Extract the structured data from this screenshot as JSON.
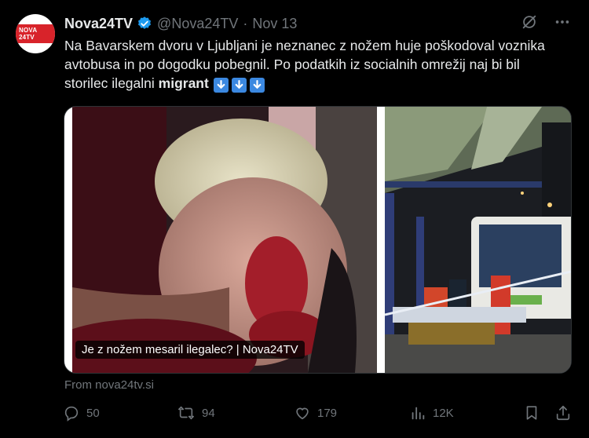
{
  "author": {
    "name": "Nova24TV",
    "handle": "@Nova24TV",
    "separator": "·",
    "date": "Nov 13",
    "avatar_text": "NOVA 24TV"
  },
  "tweet": {
    "text_main": "Na Bavarskem dvoru v Ljubljani je neznanec z nožem huje poškodoval voznika avtobusa in po dogodku pobegnil. Po podatkih iz socialnih omrežij naj bi bil storilec ilegalni ",
    "text_bold": "migrant",
    "arrow_emoji": "⬇️"
  },
  "media": {
    "caption": "Je z nožem mesaril ilegalec? | Nova24TV",
    "source": "From nova24tv.si"
  },
  "actions": {
    "replies": "50",
    "reposts": "94",
    "likes": "179",
    "views": "12K"
  },
  "colors": {
    "background": "#000000",
    "text": "#e7e9ea",
    "muted": "#71767b",
    "verified": "#1d9bf0",
    "brand_red": "#d8232a"
  },
  "icons": [
    "verified-badge-icon",
    "grok-icon",
    "more-icon",
    "reply-icon",
    "repost-icon",
    "like-icon",
    "views-icon",
    "bookmark-icon",
    "share-icon",
    "arrow-down-icon"
  ]
}
